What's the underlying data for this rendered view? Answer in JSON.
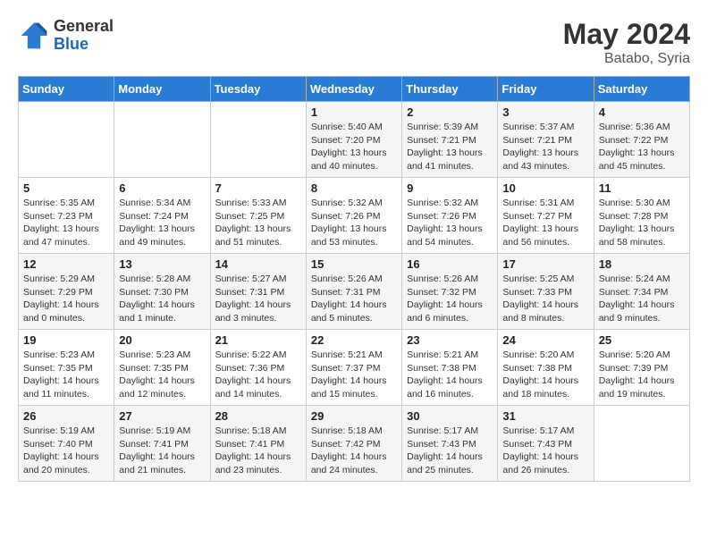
{
  "logo": {
    "general": "General",
    "blue": "Blue"
  },
  "title": {
    "month_year": "May 2024",
    "location": "Batabo, Syria"
  },
  "days_of_week": [
    "Sunday",
    "Monday",
    "Tuesday",
    "Wednesday",
    "Thursday",
    "Friday",
    "Saturday"
  ],
  "weeks": [
    [
      {
        "day": "",
        "info": ""
      },
      {
        "day": "",
        "info": ""
      },
      {
        "day": "",
        "info": ""
      },
      {
        "day": "1",
        "info": "Sunrise: 5:40 AM\nSunset: 7:20 PM\nDaylight: 13 hours\nand 40 minutes."
      },
      {
        "day": "2",
        "info": "Sunrise: 5:39 AM\nSunset: 7:21 PM\nDaylight: 13 hours\nand 41 minutes."
      },
      {
        "day": "3",
        "info": "Sunrise: 5:37 AM\nSunset: 7:21 PM\nDaylight: 13 hours\nand 43 minutes."
      },
      {
        "day": "4",
        "info": "Sunrise: 5:36 AM\nSunset: 7:22 PM\nDaylight: 13 hours\nand 45 minutes."
      }
    ],
    [
      {
        "day": "5",
        "info": "Sunrise: 5:35 AM\nSunset: 7:23 PM\nDaylight: 13 hours\nand 47 minutes."
      },
      {
        "day": "6",
        "info": "Sunrise: 5:34 AM\nSunset: 7:24 PM\nDaylight: 13 hours\nand 49 minutes."
      },
      {
        "day": "7",
        "info": "Sunrise: 5:33 AM\nSunset: 7:25 PM\nDaylight: 13 hours\nand 51 minutes."
      },
      {
        "day": "8",
        "info": "Sunrise: 5:32 AM\nSunset: 7:26 PM\nDaylight: 13 hours\nand 53 minutes."
      },
      {
        "day": "9",
        "info": "Sunrise: 5:32 AM\nSunset: 7:26 PM\nDaylight: 13 hours\nand 54 minutes."
      },
      {
        "day": "10",
        "info": "Sunrise: 5:31 AM\nSunset: 7:27 PM\nDaylight: 13 hours\nand 56 minutes."
      },
      {
        "day": "11",
        "info": "Sunrise: 5:30 AM\nSunset: 7:28 PM\nDaylight: 13 hours\nand 58 minutes."
      }
    ],
    [
      {
        "day": "12",
        "info": "Sunrise: 5:29 AM\nSunset: 7:29 PM\nDaylight: 14 hours\nand 0 minutes."
      },
      {
        "day": "13",
        "info": "Sunrise: 5:28 AM\nSunset: 7:30 PM\nDaylight: 14 hours\nand 1 minute."
      },
      {
        "day": "14",
        "info": "Sunrise: 5:27 AM\nSunset: 7:31 PM\nDaylight: 14 hours\nand 3 minutes."
      },
      {
        "day": "15",
        "info": "Sunrise: 5:26 AM\nSunset: 7:31 PM\nDaylight: 14 hours\nand 5 minutes."
      },
      {
        "day": "16",
        "info": "Sunrise: 5:26 AM\nSunset: 7:32 PM\nDaylight: 14 hours\nand 6 minutes."
      },
      {
        "day": "17",
        "info": "Sunrise: 5:25 AM\nSunset: 7:33 PM\nDaylight: 14 hours\nand 8 minutes."
      },
      {
        "day": "18",
        "info": "Sunrise: 5:24 AM\nSunset: 7:34 PM\nDaylight: 14 hours\nand 9 minutes."
      }
    ],
    [
      {
        "day": "19",
        "info": "Sunrise: 5:23 AM\nSunset: 7:35 PM\nDaylight: 14 hours\nand 11 minutes."
      },
      {
        "day": "20",
        "info": "Sunrise: 5:23 AM\nSunset: 7:35 PM\nDaylight: 14 hours\nand 12 minutes."
      },
      {
        "day": "21",
        "info": "Sunrise: 5:22 AM\nSunset: 7:36 PM\nDaylight: 14 hours\nand 14 minutes."
      },
      {
        "day": "22",
        "info": "Sunrise: 5:21 AM\nSunset: 7:37 PM\nDaylight: 14 hours\nand 15 minutes."
      },
      {
        "day": "23",
        "info": "Sunrise: 5:21 AM\nSunset: 7:38 PM\nDaylight: 14 hours\nand 16 minutes."
      },
      {
        "day": "24",
        "info": "Sunrise: 5:20 AM\nSunset: 7:38 PM\nDaylight: 14 hours\nand 18 minutes."
      },
      {
        "day": "25",
        "info": "Sunrise: 5:20 AM\nSunset: 7:39 PM\nDaylight: 14 hours\nand 19 minutes."
      }
    ],
    [
      {
        "day": "26",
        "info": "Sunrise: 5:19 AM\nSunset: 7:40 PM\nDaylight: 14 hours\nand 20 minutes."
      },
      {
        "day": "27",
        "info": "Sunrise: 5:19 AM\nSunset: 7:41 PM\nDaylight: 14 hours\nand 21 minutes."
      },
      {
        "day": "28",
        "info": "Sunrise: 5:18 AM\nSunset: 7:41 PM\nDaylight: 14 hours\nand 23 minutes."
      },
      {
        "day": "29",
        "info": "Sunrise: 5:18 AM\nSunset: 7:42 PM\nDaylight: 14 hours\nand 24 minutes."
      },
      {
        "day": "30",
        "info": "Sunrise: 5:17 AM\nSunset: 7:43 PM\nDaylight: 14 hours\nand 25 minutes."
      },
      {
        "day": "31",
        "info": "Sunrise: 5:17 AM\nSunset: 7:43 PM\nDaylight: 14 hours\nand 26 minutes."
      },
      {
        "day": "",
        "info": ""
      }
    ]
  ]
}
